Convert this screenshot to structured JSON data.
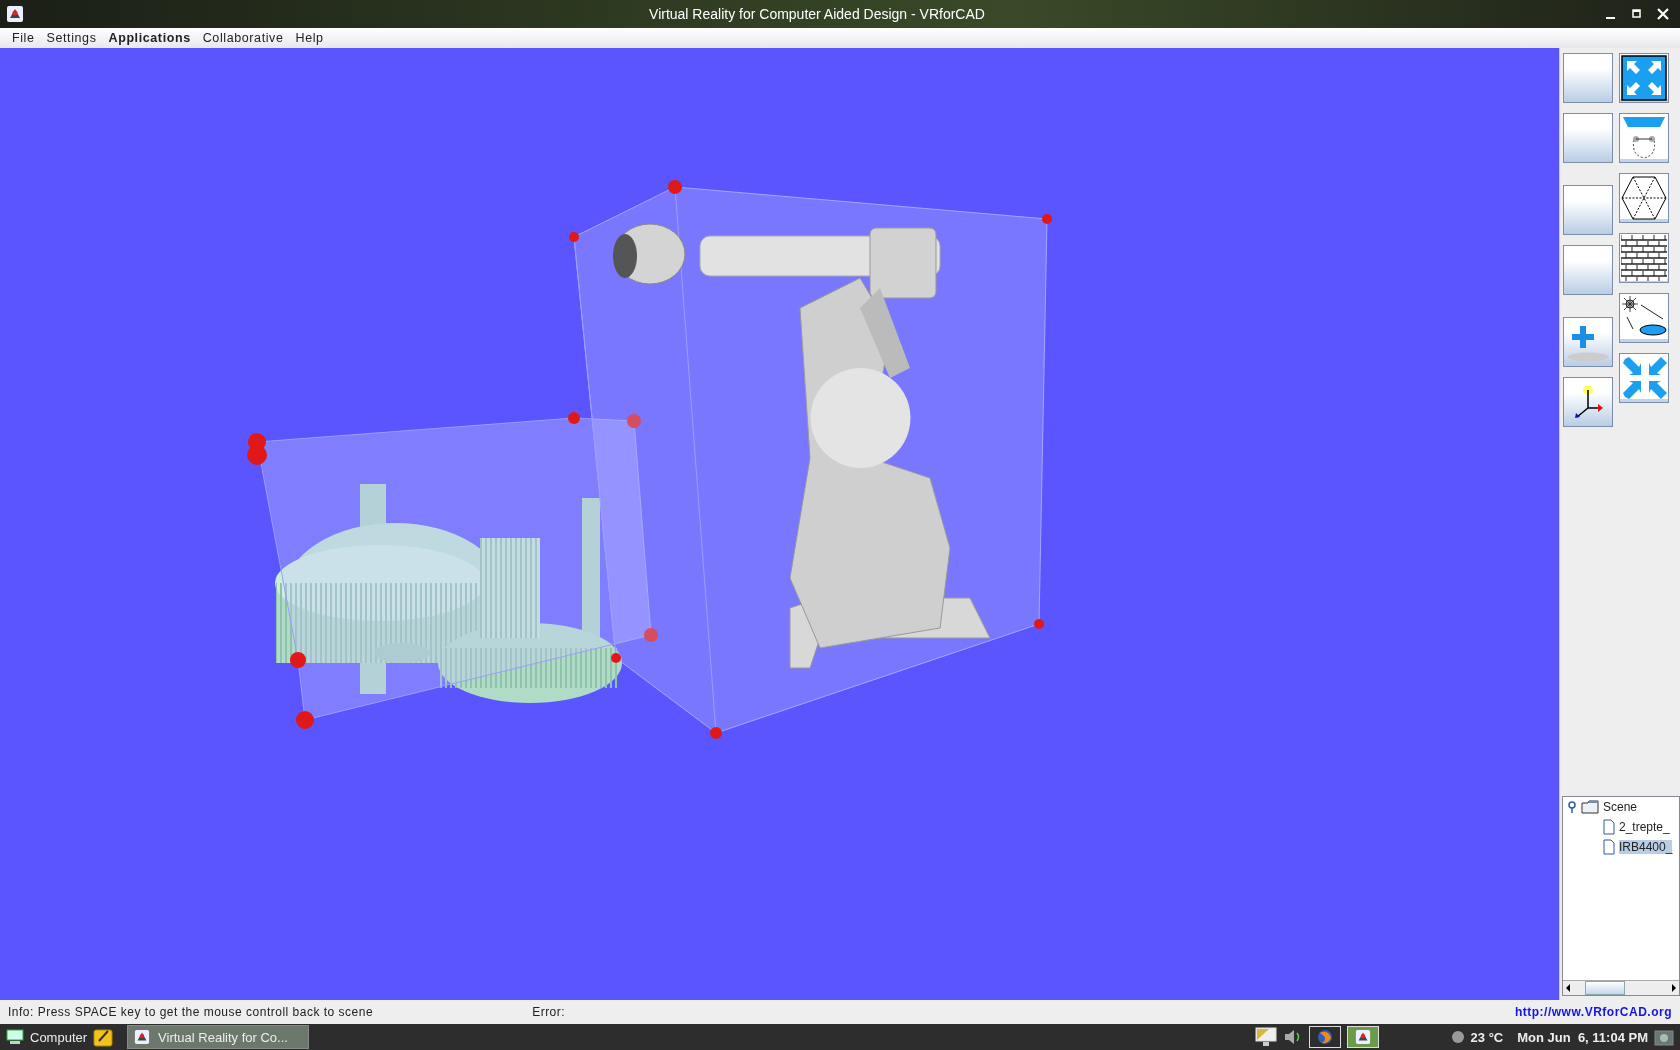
{
  "window": {
    "title": "Virtual Reality for Computer Aided Design - VRforCAD"
  },
  "menu": [
    {
      "label": "File",
      "highlighted": false
    },
    {
      "label": "Settings",
      "highlighted": false
    },
    {
      "label": "Applications",
      "highlighted": true
    },
    {
      "label": "Collaborative",
      "highlighted": false
    },
    {
      "label": "Help",
      "highlighted": false
    }
  ],
  "left_tools": [
    {
      "kind": "blank"
    },
    {
      "kind": "blank"
    },
    {
      "kind": "blank"
    },
    {
      "kind": "blank"
    },
    {
      "kind": "add-plane"
    },
    {
      "kind": "axes"
    }
  ],
  "right_tools": [
    {
      "kind": "expand"
    },
    {
      "kind": "projector"
    },
    {
      "kind": "wireframe"
    },
    {
      "kind": "bricks"
    },
    {
      "kind": "light"
    },
    {
      "kind": "shrink"
    }
  ],
  "tree": {
    "label": "Scene",
    "expanded": true,
    "children": [
      {
        "label": "2_trepte_",
        "selected": false
      },
      {
        "label": "IRB4400_",
        "selected": true
      }
    ]
  },
  "status_bar": {
    "info": "Info: Press SPACE key to get the mouse controll back to scene",
    "error": "Error:",
    "link": "http://www.VRforCAD.org"
  },
  "taskbar": {
    "start": "Computer",
    "window_button": "Virtual Reality for Co...",
    "temperature": "23 °C",
    "clock": "Mon Jun  6, 11:04 PM"
  }
}
